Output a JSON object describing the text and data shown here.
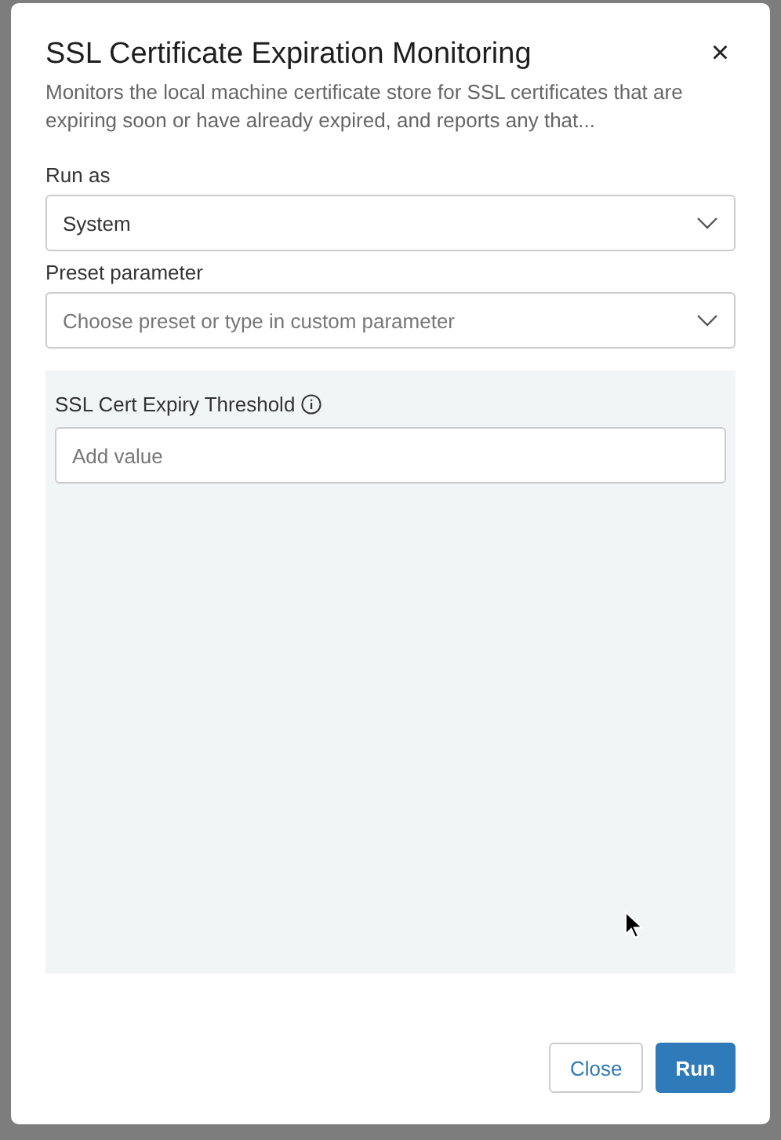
{
  "dialog": {
    "title": "SSL Certificate Expiration Monitoring",
    "close": "×",
    "description": "Monitors the local machine certificate store for SSL certificates that are expiring soon or have already expired, and reports any that..."
  },
  "run_as": {
    "label": "Run as",
    "value": "System"
  },
  "preset": {
    "label": "Preset parameter",
    "placeholder": "Choose preset or type in custom parameter"
  },
  "parameters": [
    {
      "label": "SSL Cert Expiry Threshold",
      "placeholder": "Add value"
    }
  ],
  "buttons": [
    {
      "label": "Close",
      "kind": "secondary"
    },
    {
      "label": "Run",
      "kind": "primary"
    }
  ]
}
